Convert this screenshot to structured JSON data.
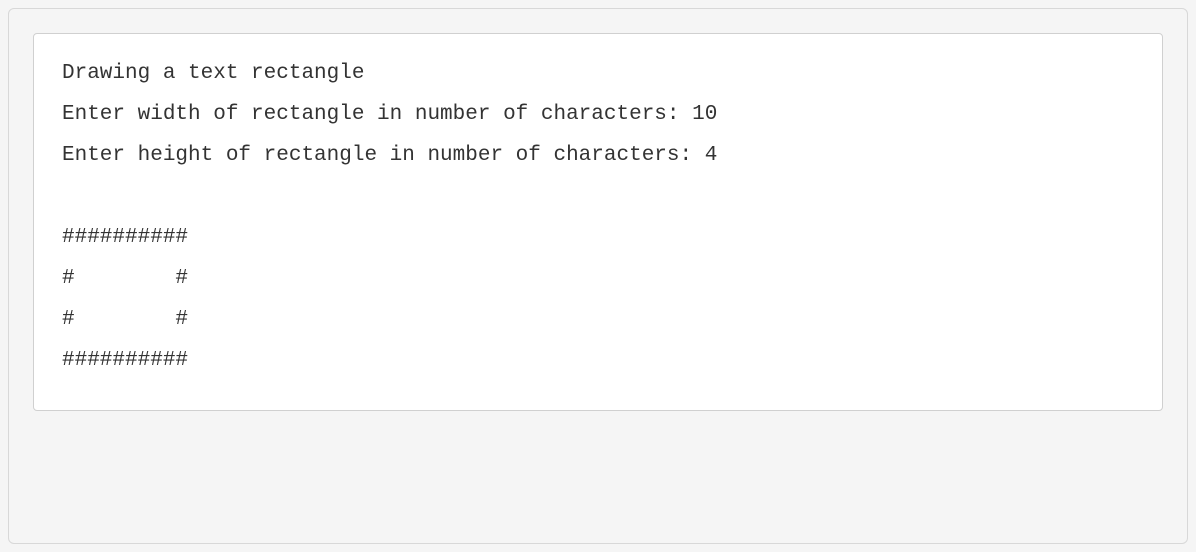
{
  "output": {
    "lines": [
      "Drawing a text rectangle",
      "Enter width of rectangle in number of characters: 10",
      "Enter height of rectangle in number of characters: 4",
      "",
      "##########",
      "#        #",
      "#        #",
      "##########"
    ]
  }
}
